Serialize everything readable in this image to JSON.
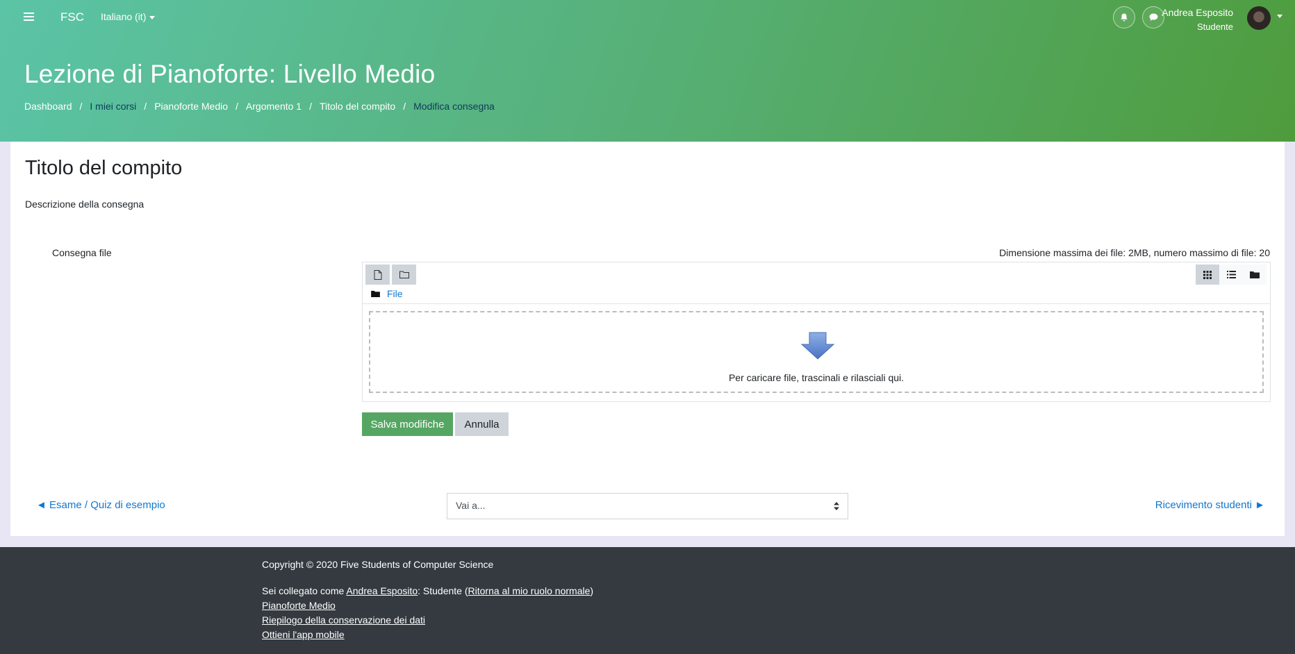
{
  "topbar": {
    "brand": "FSC",
    "language": "Italiano (it)",
    "user_name": "Andrea Esposito",
    "user_role": "Studente"
  },
  "header": {
    "course_title": "Lezione di Pianoforte: Livello Medio",
    "breadcrumb": [
      "Dashboard",
      "I miei corsi",
      "Pianoforte Medio",
      "Argomento 1",
      "Titolo del compito",
      "Modifica consegna"
    ],
    "breadcrumb_sep": "/"
  },
  "main": {
    "page_title": "Titolo del compito",
    "description": "Descrizione della consegna",
    "field_label": "Consegna file",
    "limits": "Dimensione massima dei file: 2MB, numero massimo di file: 20",
    "filemanager": {
      "path_label": "File",
      "drop_text": "Per caricare file, trascinali e rilasciali qui."
    },
    "save_label": "Salva modifiche",
    "cancel_label": "Annulla"
  },
  "activity_nav": {
    "prev": "◄ Esame / Quiz di esempio",
    "jump_placeholder": "Vai a...",
    "next": "Ricevimento studenti ►"
  },
  "footer": {
    "copyright": "Copyright © 2020 Five Students of Computer Science",
    "logged_prefix": "Sei collegato come ",
    "logged_user": "Andrea Esposito",
    "logged_middle": ": Studente (",
    "return_role": "Ritorna al mio ruolo normale",
    "logged_suffix": ")",
    "link_course": "Pianoforte Medio",
    "link_data": "Riepilogo della conservazione dei dati",
    "link_app": "Ottieni l'app mobile"
  },
  "colors": {
    "save_button": "#56a663",
    "link": "#1177d1",
    "footer": "#343a40"
  }
}
